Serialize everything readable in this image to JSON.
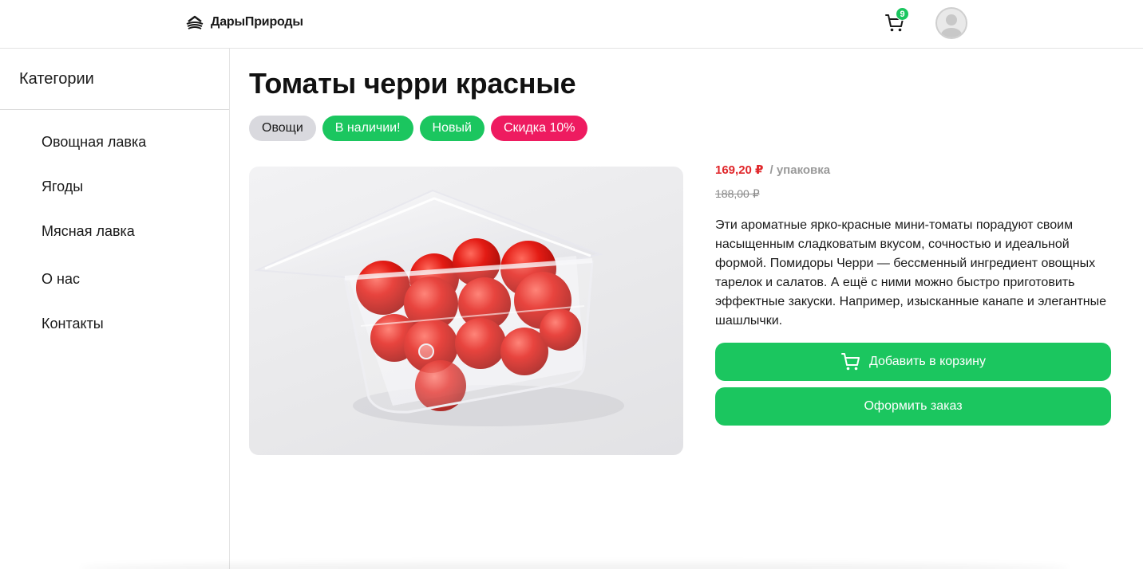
{
  "header": {
    "logo_text": "ДарыПрироды",
    "cart_count": "9"
  },
  "sidebar": {
    "title": "Категории",
    "items": [
      {
        "label": "Овощная лавка"
      },
      {
        "label": "Ягоды"
      },
      {
        "label": "Мясная лавка"
      },
      {
        "label": "О нас"
      },
      {
        "label": "Контакты"
      }
    ]
  },
  "product": {
    "title": "Томаты черри красные",
    "tags": [
      {
        "label": "Овощи",
        "color": "#d9d9de"
      },
      {
        "label": "В наличии!",
        "color": "#1bc65f"
      },
      {
        "label": "Новый",
        "color": "#1bc65f"
      },
      {
        "label": "Скидка 10%",
        "color": "#ee1b60"
      }
    ],
    "price": "169,20 ₽",
    "unit": "/ упаковка",
    "old_price": "188,00 ₽",
    "description": "Эти ароматные ярко-красные мини-томаты порадуют своим насыщенным сладковатым вкусом, сочностью и идеальной формой. Помидоры Черри — бессменный ингредиент овощных тарелок и салатов. А ещё с ними можно быстро приготовить эффектные закуски. Например, изысканные канапе и элегантные шашлычки.",
    "add_to_cart_label": "Добавить в корзину",
    "order_label": "Оформить заказ",
    "image_icon": "cherry-tomatoes-in-plastic-box"
  },
  "colors": {
    "accent": "#1bc65f",
    "price": "#e0272b",
    "discount": "#ee1b60"
  }
}
